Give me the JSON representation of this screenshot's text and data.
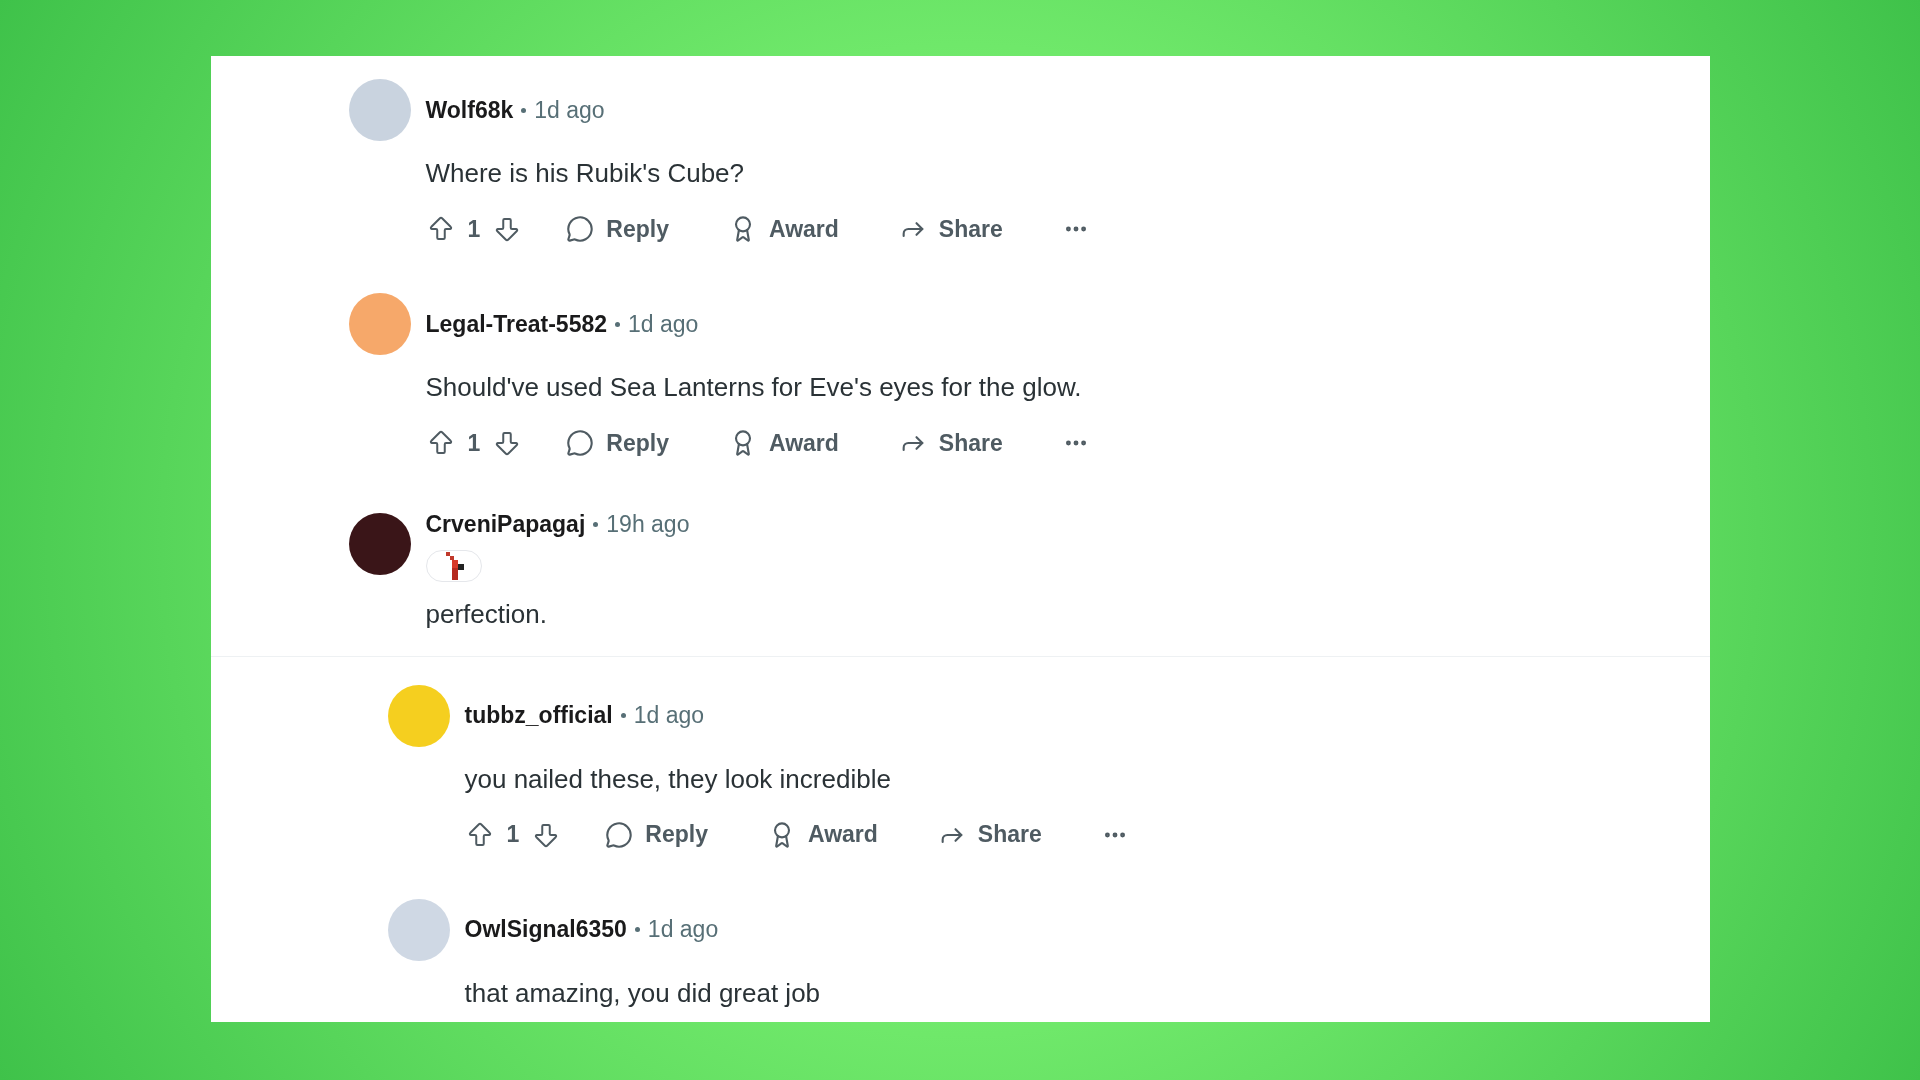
{
  "comments": [
    {
      "author": "Wolf68k",
      "time": "1d ago",
      "color": "#c9d3df",
      "body": "Where is his Rubik's Cube?",
      "actions": {
        "votes": "1",
        "reply": "Reply",
        "award": "Award",
        "share": "Share"
      }
    },
    {
      "author": "Legal-Treat-5582",
      "time": "1d ago",
      "color": "#f6a86a",
      "body": "Should've used Sea Lanterns for Eve's eyes for the glow.",
      "actions": {
        "votes": "1",
        "reply": "Reply",
        "award": "Award",
        "share": "Share"
      }
    },
    {
      "author": "CrveniPapagaj",
      "time": "19h ago",
      "color": "#3a1518",
      "flair": true,
      "body": "perfection.",
      "children": [
        {
          "author": "tubbz_official",
          "time": "1d ago",
          "color": "#f5cf1f",
          "body": "you nailed these, they look incredible",
          "actions": {
            "votes": "1",
            "reply": "Reply",
            "award": "Award",
            "share": "Share"
          }
        },
        {
          "author": "OwlSignal6350",
          "time": "1d ago",
          "color": "#cfd8e4",
          "body": "that amazing, you did great job"
        }
      ]
    }
  ]
}
